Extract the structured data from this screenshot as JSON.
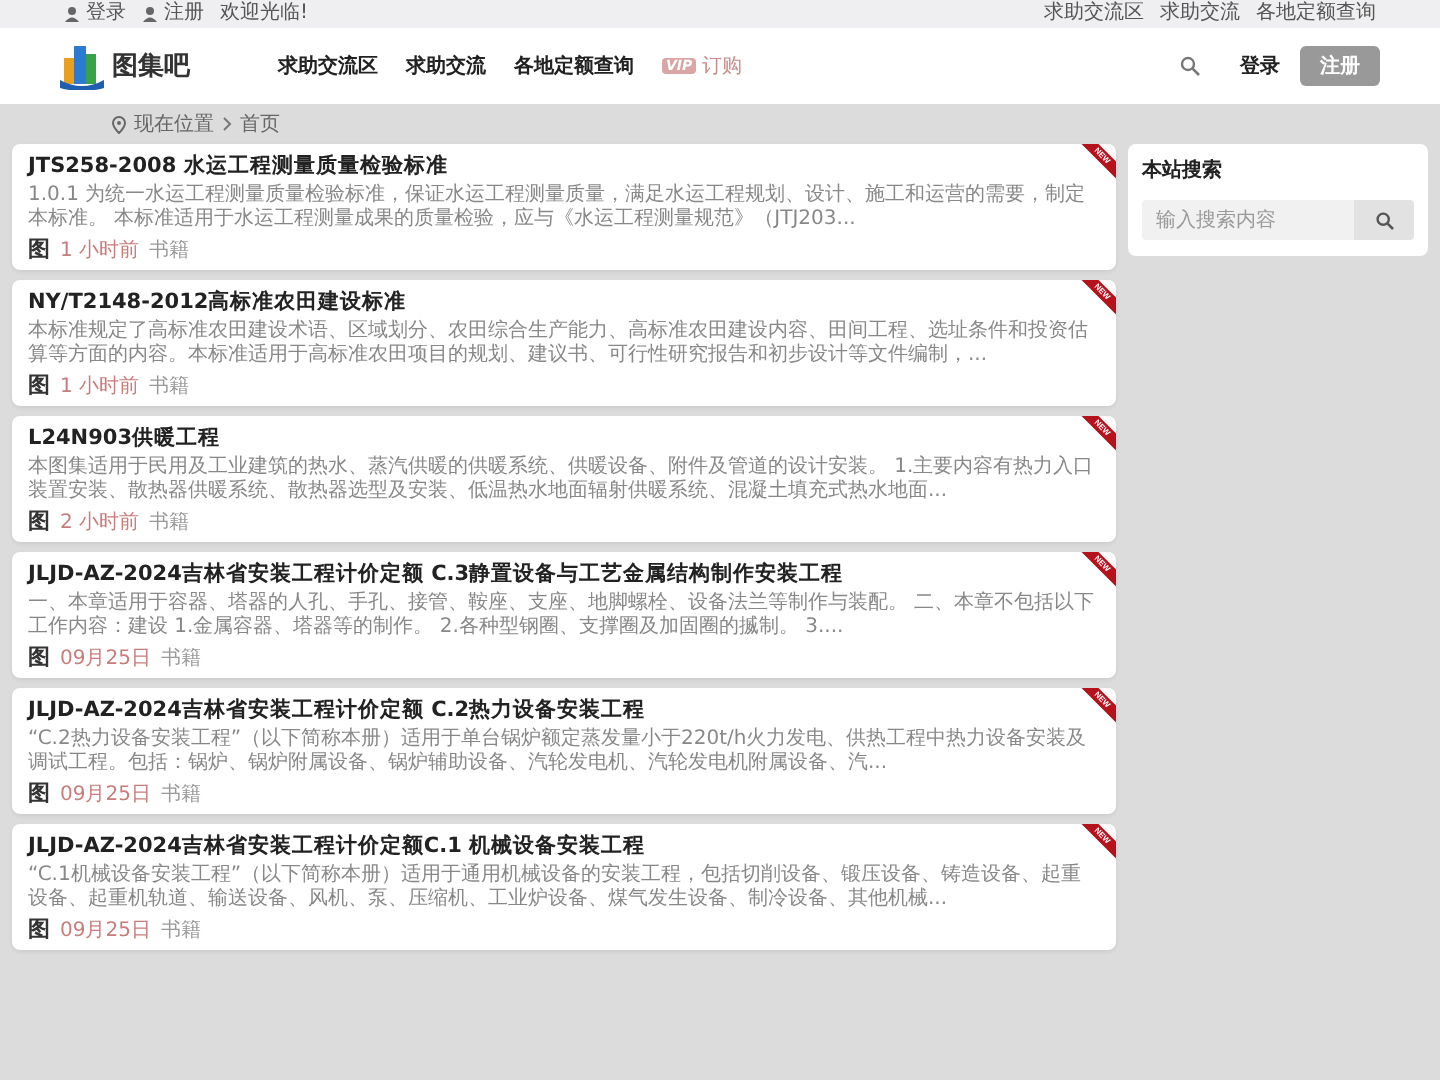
{
  "top_bar": {
    "left_links": [
      {
        "label": "登录"
      },
      {
        "label": "注册"
      }
    ],
    "welcome": "欢迎光临!",
    "right_links": [
      "求助交流区",
      "求助交流",
      "各地定额查询"
    ]
  },
  "header": {
    "logo_text": "图集吧",
    "nav": [
      {
        "kind": "link",
        "label": "求助交流区"
      },
      {
        "kind": "link",
        "label": "求助交流"
      },
      {
        "kind": "link",
        "label": "各地定额查询"
      },
      {
        "kind": "vip",
        "badge": "VIP",
        "label": "订购"
      }
    ],
    "login": "登录",
    "register": "注册"
  },
  "breadcrumb": [
    "现在位置",
    "首页"
  ],
  "posts": [
    {
      "title": "JTS258-2008 水运工程测量质量检验标准",
      "excerpt": "1.0.1 为统一水运工程测量质量检验标准，保证水运工程测量质量，满足水运工程规划、设计、施工和运营的需要，制定本标准。 本标准适用于水运工程测量成果的质量检验，应与《水运工程测量规范》（JTJ203...",
      "type_icon": "图",
      "time": "1 小时前",
      "category": "书籍",
      "ribbon": "NEW"
    },
    {
      "title": "NY/T2148-2012高标准农田建设标准",
      "excerpt": "本标准规定了高标准农田建设术语、区域划分、农田综合生产能力、高标准农田建设内容、田间工程、选址条件和投资估算等方面的内容。本标准适用于高标准农田项目的规划、建议书、可行性研究报告和初步设计等文件编制，...",
      "type_icon": "图",
      "time": "1 小时前",
      "category": "书籍",
      "ribbon": "NEW"
    },
    {
      "title": "L24N903供暖工程",
      "excerpt": "本图集适用于民用及工业建筑的热水、蒸汽供暖的供暖系统、供暖设备、附件及管道的设计安装。 1.主要内容有热力入口装置安装、散热器供暖系统、散热器选型及安装、低温热水地面辐射供暖系统、混凝土填充式热水地面...",
      "type_icon": "图",
      "time": "2 小时前",
      "category": "书籍",
      "ribbon": "NEW"
    },
    {
      "title": "JLJD-AZ-2024吉林省安装工程计价定额 C.3静置设备与工艺金属结构制作安装工程",
      "excerpt": "一、本章适用于容器、塔器的人孔、手孔、接管、鞍座、支座、地脚螺栓、设备法兰等制作与装配。 二、本章不包括以下工作内容：建设 1.金属容器、塔器等的制作。 2.各种型钢圈、支撑圈及加固圈的揻制。 3....",
      "type_icon": "图",
      "time": "09月25日",
      "category": "书籍",
      "ribbon": "NEW"
    },
    {
      "title": "JLJD-AZ-2024吉林省安装工程计价定额 C.2热力设备安装工程",
      "excerpt": "“C.2热力设备安装工程”（以下简称本册）适用于单台锅炉额定蒸发量小于220t/h火力发电、供热工程中热力设备安装及调试工程。包括：锅炉、锅炉附属设备、锅炉辅助设备、汽轮发电机、汽轮发电机附属设备、汽...",
      "type_icon": "图",
      "time": "09月25日",
      "category": "书籍",
      "ribbon": "NEW"
    },
    {
      "title": "JLJD-AZ-2024吉林省安装工程计价定额C.1 机械设备安装工程",
      "excerpt": "“C.1机械设备安装工程”（以下简称本册）适用于通用机械设备的安装工程，包括切削设备、锻压设备、铸造设备、起重设备、起重机轨道、输送设备、风机、泵、压缩机、工业炉设备、煤气发生设备、制冷设备、其他机械...",
      "type_icon": "图",
      "time": "09月25日",
      "category": "书籍",
      "ribbon": "NEW"
    }
  ],
  "sidebar": {
    "title": "本站搜索",
    "placeholder": "输入搜索内容"
  }
}
